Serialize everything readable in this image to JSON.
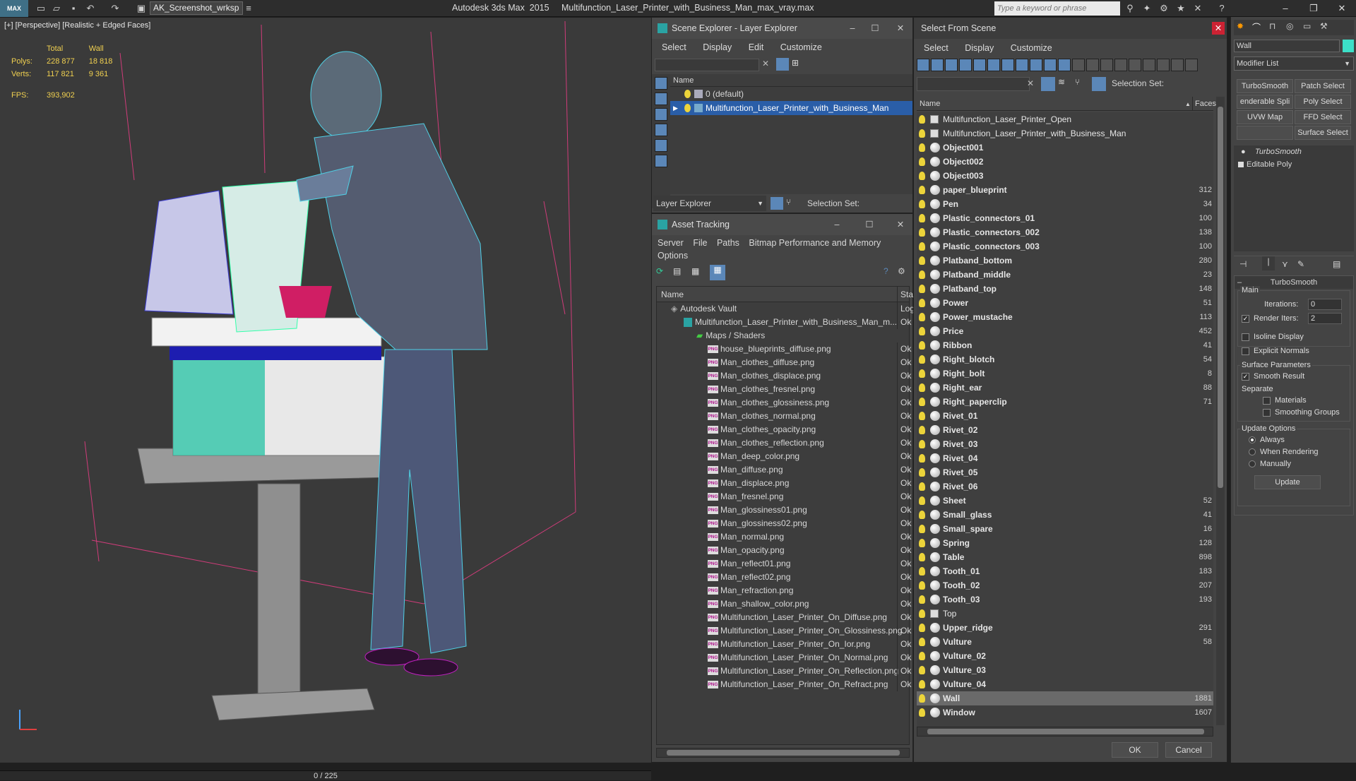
{
  "titlebar": {
    "app_badge": "MAX",
    "workspace": "AK_Screenshot_wrksp",
    "title": "Autodesk 3ds Max  2015     Multifunction_Laser_Printer_with_Business_Man_max_vray.max",
    "search_placeholder": "Type a keyword or phrase"
  },
  "viewport": {
    "label": "[+] [Perspective] [Realistic + Edged Faces]",
    "stats": {
      "total_header": "Total",
      "wall_header": "Wall",
      "polys_label": "Polys:",
      "polys_total": "228 877",
      "polys_wall": "18 818",
      "verts_label": "Verts:",
      "verts_total": "117 821",
      "verts_wall": "9 361",
      "fps_label": "FPS:",
      "fps_value": "393,902"
    },
    "timeline": "0 / 225"
  },
  "scene_explorer": {
    "title": "Scene Explorer - Layer Explorer",
    "menu": [
      "Select",
      "Display",
      "Edit",
      "Customize"
    ],
    "column_name": "Name",
    "layers": [
      "0 (default)",
      "Multifunction_Laser_Printer_with_Business_Man"
    ],
    "footer_mode": "Layer Explorer",
    "footer_selset": "Selection Set:"
  },
  "asset_tracking": {
    "title": "Asset Tracking",
    "menu": [
      "Server",
      "File",
      "Paths",
      "Bitmap Performance and Memory"
    ],
    "menu2": "Options",
    "col_name": "Name",
    "col_status": "Stat",
    "vault": "Autodesk Vault",
    "vault_status": "Log",
    "file": "Multifunction_Laser_Printer_with_Business_Man_m...",
    "file_status": "Ok",
    "maps_folder": "Maps / Shaders",
    "maps": [
      "house_blueprints_diffuse.png",
      "Man_clothes_diffuse.png",
      "Man_clothes_displace.png",
      "Man_clothes_fresnel.png",
      "Man_clothes_glossiness.png",
      "Man_clothes_normal.png",
      "Man_clothes_opacity.png",
      "Man_clothes_reflection.png",
      "Man_deep_color.png",
      "Man_diffuse.png",
      "Man_displace.png",
      "Man_fresnel.png",
      "Man_glossiness01.png",
      "Man_glossiness02.png",
      "Man_normal.png",
      "Man_opacity.png",
      "Man_reflect01.png",
      "Man_reflect02.png",
      "Man_refraction.png",
      "Man_shallow_color.png",
      "Multifunction_Laser_Printer_On_Diffuse.png",
      "Multifunction_Laser_Printer_On_Glossiness.png",
      "Multifunction_Laser_Printer_On_Ior.png",
      "Multifunction_Laser_Printer_On_Normal.png",
      "Multifunction_Laser_Printer_On_Reflection.png",
      "Multifunction_Laser_Printer_On_Refract.png"
    ],
    "ok": "Ok",
    "png_badge": "PNG"
  },
  "select_from_scene": {
    "title": "Select From Scene",
    "menu": [
      "Select",
      "Display",
      "Customize"
    ],
    "selection_set": "Selection Set:",
    "col_name": "Name",
    "col_faces": "Faces",
    "ok": "OK",
    "cancel": "Cancel",
    "items": [
      {
        "name": "Multifunction_Laser_Printer_Open",
        "faces": "",
        "type": "group"
      },
      {
        "name": "Multifunction_Laser_Printer_with_Business_Man",
        "faces": "",
        "type": "group"
      },
      {
        "name": "Object001",
        "faces": "",
        "type": "obj"
      },
      {
        "name": "Object002",
        "faces": "",
        "type": "obj"
      },
      {
        "name": "Object003",
        "faces": "",
        "type": "obj"
      },
      {
        "name": "paper_blueprint",
        "faces": "312",
        "type": "obj"
      },
      {
        "name": "Pen",
        "faces": "34",
        "type": "obj"
      },
      {
        "name": "Plastic_connectors_01",
        "faces": "100",
        "type": "obj"
      },
      {
        "name": "Plastic_connectors_002",
        "faces": "138",
        "type": "obj"
      },
      {
        "name": "Plastic_connectors_003",
        "faces": "100",
        "type": "obj"
      },
      {
        "name": "Platband_bottom",
        "faces": "280",
        "type": "obj"
      },
      {
        "name": "Platband_middle",
        "faces": "23",
        "type": "obj"
      },
      {
        "name": "Platband_top",
        "faces": "148",
        "type": "obj"
      },
      {
        "name": "Power",
        "faces": "51",
        "type": "obj"
      },
      {
        "name": "Power_mustache",
        "faces": "113",
        "type": "obj"
      },
      {
        "name": "Price",
        "faces": "452",
        "type": "obj"
      },
      {
        "name": "Ribbon",
        "faces": "41",
        "type": "obj"
      },
      {
        "name": "Right_blotch",
        "faces": "54",
        "type": "obj"
      },
      {
        "name": "Right_bolt",
        "faces": "8",
        "type": "obj"
      },
      {
        "name": "Right_ear",
        "faces": "88",
        "type": "obj"
      },
      {
        "name": "Right_paperclip",
        "faces": "71",
        "type": "obj"
      },
      {
        "name": "Rivet_01",
        "faces": "",
        "type": "obj"
      },
      {
        "name": "Rivet_02",
        "faces": "",
        "type": "obj"
      },
      {
        "name": "Rivet_03",
        "faces": "",
        "type": "obj"
      },
      {
        "name": "Rivet_04",
        "faces": "",
        "type": "obj"
      },
      {
        "name": "Rivet_05",
        "faces": "",
        "type": "obj"
      },
      {
        "name": "Rivet_06",
        "faces": "",
        "type": "obj"
      },
      {
        "name": "Sheet",
        "faces": "52",
        "type": "obj"
      },
      {
        "name": "Small_glass",
        "faces": "41",
        "type": "obj"
      },
      {
        "name": "Small_spare",
        "faces": "16",
        "type": "obj"
      },
      {
        "name": "Spring",
        "faces": "128",
        "type": "obj"
      },
      {
        "name": "Table",
        "faces": "898",
        "type": "obj"
      },
      {
        "name": "Tooth_01",
        "faces": "183",
        "type": "obj"
      },
      {
        "name": "Tooth_02",
        "faces": "207",
        "type": "obj"
      },
      {
        "name": "Tooth_03",
        "faces": "193",
        "type": "obj"
      },
      {
        "name": "Top",
        "faces": "",
        "type": "group"
      },
      {
        "name": "Upper_ridge",
        "faces": "291",
        "type": "obj"
      },
      {
        "name": "Vulture",
        "faces": "58",
        "type": "obj"
      },
      {
        "name": "Vulture_02",
        "faces": "",
        "type": "obj"
      },
      {
        "name": "Vulture_03",
        "faces": "",
        "type": "obj"
      },
      {
        "name": "Vulture_04",
        "faces": "",
        "type": "obj"
      },
      {
        "name": "Wall",
        "faces": "1881",
        "type": "obj",
        "selected": true
      },
      {
        "name": "Window",
        "faces": "1607",
        "type": "obj"
      }
    ]
  },
  "command_panel": {
    "object_name": "Wall",
    "modifier_list": "Modifier List",
    "buttons": [
      "TurboSmooth",
      "Patch Select",
      "enderable Spli",
      "Poly Select",
      "UVW Map",
      "FFD Select",
      "",
      "Surface Select"
    ],
    "stack": [
      "TurboSmooth",
      "Editable Poly"
    ],
    "rollout_title": "TurboSmooth",
    "main_label": "Main",
    "iterations_label": "Iterations:",
    "iterations_value": "0",
    "render_iters_label": "Render Iters:",
    "render_iters_value": "2",
    "isoline": "Isoline Display",
    "explicit_normals": "Explicit Normals",
    "surface_params": "Surface Parameters",
    "smooth_result": "Smooth Result",
    "separate": "Separate",
    "materials": "Materials",
    "smoothing_groups": "Smoothing Groups",
    "update_options": "Update Options",
    "always": "Always",
    "when_rendering": "When Rendering",
    "manually": "Manually",
    "update": "Update"
  }
}
